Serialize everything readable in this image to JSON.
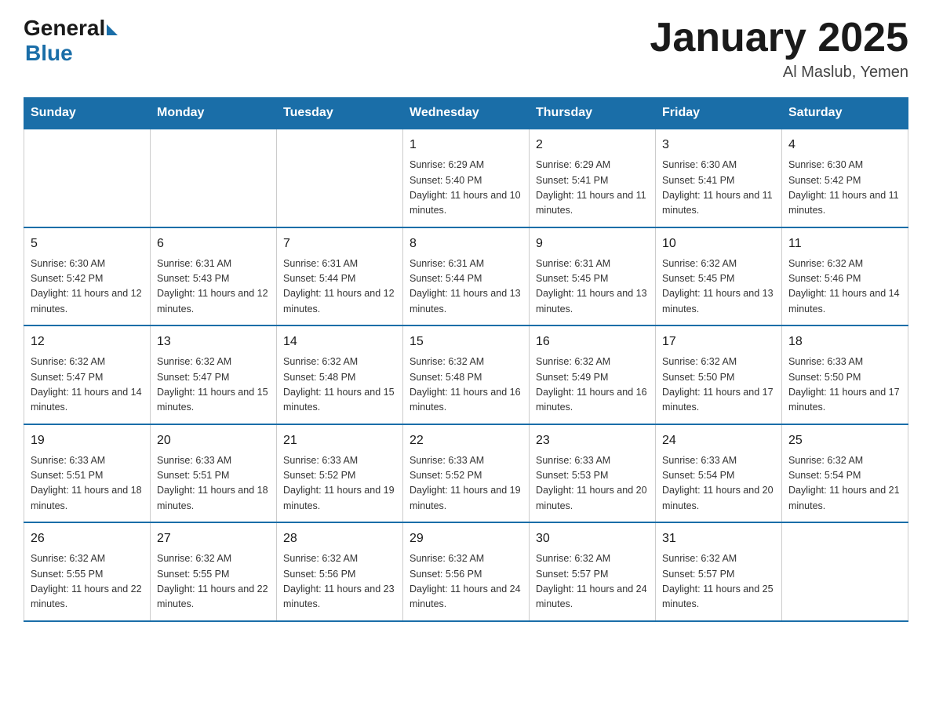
{
  "header": {
    "logo_general": "General",
    "logo_blue": "Blue",
    "month_title": "January 2025",
    "location": "Al Maslub, Yemen"
  },
  "weekdays": [
    "Sunday",
    "Monday",
    "Tuesday",
    "Wednesday",
    "Thursday",
    "Friday",
    "Saturday"
  ],
  "weeks": [
    [
      {
        "day": "",
        "info": ""
      },
      {
        "day": "",
        "info": ""
      },
      {
        "day": "",
        "info": ""
      },
      {
        "day": "1",
        "info": "Sunrise: 6:29 AM\nSunset: 5:40 PM\nDaylight: 11 hours and 10 minutes."
      },
      {
        "day": "2",
        "info": "Sunrise: 6:29 AM\nSunset: 5:41 PM\nDaylight: 11 hours and 11 minutes."
      },
      {
        "day": "3",
        "info": "Sunrise: 6:30 AM\nSunset: 5:41 PM\nDaylight: 11 hours and 11 minutes."
      },
      {
        "day": "4",
        "info": "Sunrise: 6:30 AM\nSunset: 5:42 PM\nDaylight: 11 hours and 11 minutes."
      }
    ],
    [
      {
        "day": "5",
        "info": "Sunrise: 6:30 AM\nSunset: 5:42 PM\nDaylight: 11 hours and 12 minutes."
      },
      {
        "day": "6",
        "info": "Sunrise: 6:31 AM\nSunset: 5:43 PM\nDaylight: 11 hours and 12 minutes."
      },
      {
        "day": "7",
        "info": "Sunrise: 6:31 AM\nSunset: 5:44 PM\nDaylight: 11 hours and 12 minutes."
      },
      {
        "day": "8",
        "info": "Sunrise: 6:31 AM\nSunset: 5:44 PM\nDaylight: 11 hours and 13 minutes."
      },
      {
        "day": "9",
        "info": "Sunrise: 6:31 AM\nSunset: 5:45 PM\nDaylight: 11 hours and 13 minutes."
      },
      {
        "day": "10",
        "info": "Sunrise: 6:32 AM\nSunset: 5:45 PM\nDaylight: 11 hours and 13 minutes."
      },
      {
        "day": "11",
        "info": "Sunrise: 6:32 AM\nSunset: 5:46 PM\nDaylight: 11 hours and 14 minutes."
      }
    ],
    [
      {
        "day": "12",
        "info": "Sunrise: 6:32 AM\nSunset: 5:47 PM\nDaylight: 11 hours and 14 minutes."
      },
      {
        "day": "13",
        "info": "Sunrise: 6:32 AM\nSunset: 5:47 PM\nDaylight: 11 hours and 15 minutes."
      },
      {
        "day": "14",
        "info": "Sunrise: 6:32 AM\nSunset: 5:48 PM\nDaylight: 11 hours and 15 minutes."
      },
      {
        "day": "15",
        "info": "Sunrise: 6:32 AM\nSunset: 5:48 PM\nDaylight: 11 hours and 16 minutes."
      },
      {
        "day": "16",
        "info": "Sunrise: 6:32 AM\nSunset: 5:49 PM\nDaylight: 11 hours and 16 minutes."
      },
      {
        "day": "17",
        "info": "Sunrise: 6:32 AM\nSunset: 5:50 PM\nDaylight: 11 hours and 17 minutes."
      },
      {
        "day": "18",
        "info": "Sunrise: 6:33 AM\nSunset: 5:50 PM\nDaylight: 11 hours and 17 minutes."
      }
    ],
    [
      {
        "day": "19",
        "info": "Sunrise: 6:33 AM\nSunset: 5:51 PM\nDaylight: 11 hours and 18 minutes."
      },
      {
        "day": "20",
        "info": "Sunrise: 6:33 AM\nSunset: 5:51 PM\nDaylight: 11 hours and 18 minutes."
      },
      {
        "day": "21",
        "info": "Sunrise: 6:33 AM\nSunset: 5:52 PM\nDaylight: 11 hours and 19 minutes."
      },
      {
        "day": "22",
        "info": "Sunrise: 6:33 AM\nSunset: 5:52 PM\nDaylight: 11 hours and 19 minutes."
      },
      {
        "day": "23",
        "info": "Sunrise: 6:33 AM\nSunset: 5:53 PM\nDaylight: 11 hours and 20 minutes."
      },
      {
        "day": "24",
        "info": "Sunrise: 6:33 AM\nSunset: 5:54 PM\nDaylight: 11 hours and 20 minutes."
      },
      {
        "day": "25",
        "info": "Sunrise: 6:32 AM\nSunset: 5:54 PM\nDaylight: 11 hours and 21 minutes."
      }
    ],
    [
      {
        "day": "26",
        "info": "Sunrise: 6:32 AM\nSunset: 5:55 PM\nDaylight: 11 hours and 22 minutes."
      },
      {
        "day": "27",
        "info": "Sunrise: 6:32 AM\nSunset: 5:55 PM\nDaylight: 11 hours and 22 minutes."
      },
      {
        "day": "28",
        "info": "Sunrise: 6:32 AM\nSunset: 5:56 PM\nDaylight: 11 hours and 23 minutes."
      },
      {
        "day": "29",
        "info": "Sunrise: 6:32 AM\nSunset: 5:56 PM\nDaylight: 11 hours and 24 minutes."
      },
      {
        "day": "30",
        "info": "Sunrise: 6:32 AM\nSunset: 5:57 PM\nDaylight: 11 hours and 24 minutes."
      },
      {
        "day": "31",
        "info": "Sunrise: 6:32 AM\nSunset: 5:57 PM\nDaylight: 11 hours and 25 minutes."
      },
      {
        "day": "",
        "info": ""
      }
    ]
  ]
}
